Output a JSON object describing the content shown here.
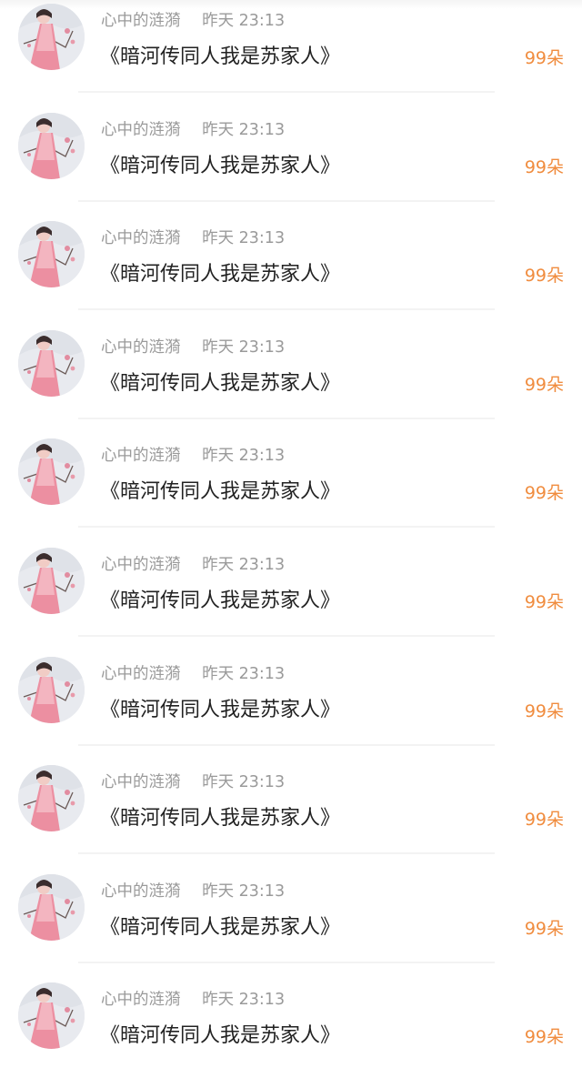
{
  "rows": [
    {
      "author": "心中的涟漪",
      "time": "昨天 23:13",
      "title": "《暗河传同人我是苏家人》",
      "gift": "99朵"
    },
    {
      "author": "心中的涟漪",
      "time": "昨天 23:13",
      "title": "《暗河传同人我是苏家人》",
      "gift": "99朵"
    },
    {
      "author": "心中的涟漪",
      "time": "昨天 23:13",
      "title": "《暗河传同人我是苏家人》",
      "gift": "99朵"
    },
    {
      "author": "心中的涟漪",
      "time": "昨天 23:13",
      "title": "《暗河传同人我是苏家人》",
      "gift": "99朵"
    },
    {
      "author": "心中的涟漪",
      "time": "昨天 23:13",
      "title": "《暗河传同人我是苏家人》",
      "gift": "99朵"
    },
    {
      "author": "心中的涟漪",
      "time": "昨天 23:13",
      "title": "《暗河传同人我是苏家人》",
      "gift": "99朵"
    },
    {
      "author": "心中的涟漪",
      "time": "昨天 23:13",
      "title": "《暗河传同人我是苏家人》",
      "gift": "99朵"
    },
    {
      "author": "心中的涟漪",
      "time": "昨天 23:13",
      "title": "《暗河传同人我是苏家人》",
      "gift": "99朵"
    },
    {
      "author": "心中的涟漪",
      "time": "昨天 23:13",
      "title": "《暗河传同人我是苏家人》",
      "gift": "99朵"
    },
    {
      "author": "心中的涟漪",
      "time": "昨天 23:13",
      "title": "《暗河传同人我是苏家人》",
      "gift": "99朵"
    }
  ],
  "colors": {
    "gift": "#f08c3e",
    "meta": "#9a9a9a",
    "title": "#222222",
    "divider": "#f3f3f3"
  },
  "icons": {
    "avatar": "user-avatar-image"
  }
}
